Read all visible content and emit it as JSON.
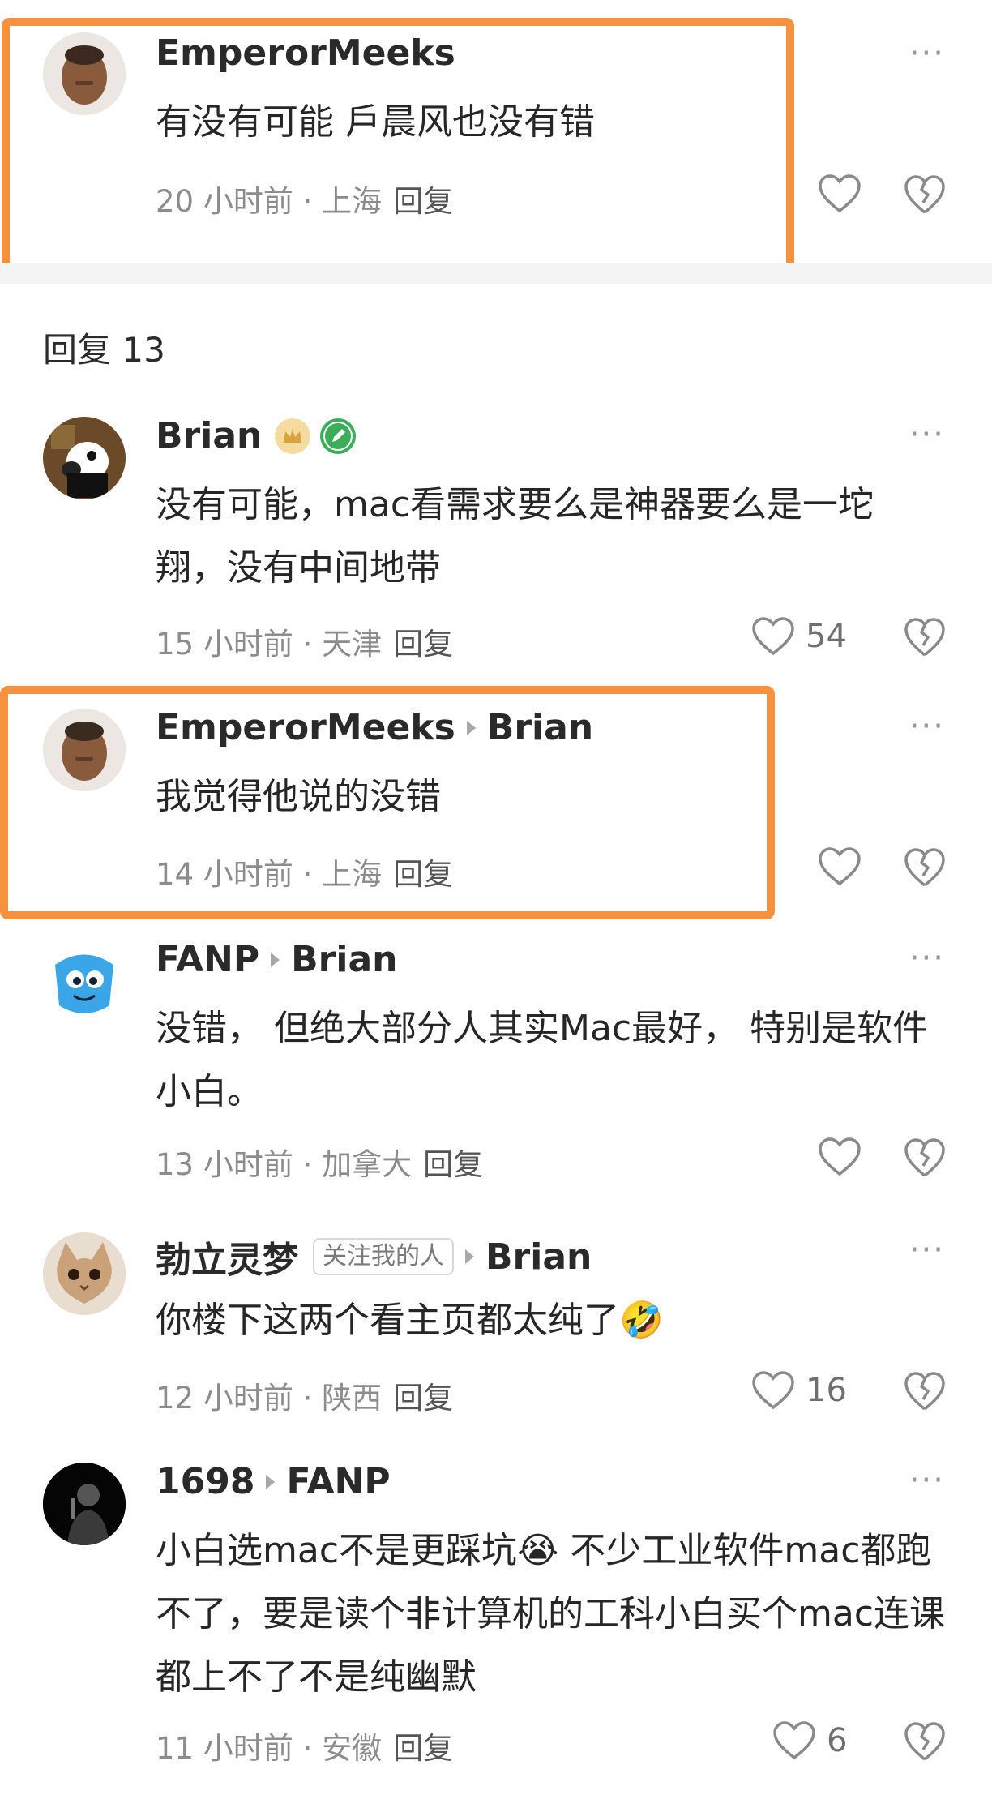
{
  "top_comment": {
    "user": "EmperorMeeks",
    "text": "有没有可能 戶晨风也没有错",
    "time": "20 小时前",
    "location": "上海",
    "reply": "回复"
  },
  "replies_header": "回复 13",
  "replies": [
    {
      "user": "Brian",
      "text": "没有可能，mac看需求要么是神器要么是一坨翔，没有中间地带",
      "time": "15 小时前",
      "location": "天津",
      "reply": "回复",
      "likes": "54"
    },
    {
      "user": "EmperorMeeks",
      "target": "Brian",
      "text": "我觉得他说的没错",
      "time": "14 小时前",
      "location": "上海",
      "reply": "回复",
      "likes": ""
    },
    {
      "user": "FANP",
      "target": "Brian",
      "text": "没错， 但绝大部分人其实Mac最好， 特别是软件小白。",
      "time": "13 小时前",
      "location": "加拿大",
      "reply": "回复",
      "likes": ""
    },
    {
      "user": "勃立灵梦",
      "tag": "关注我的人",
      "target": "Brian",
      "text": "你楼下这两个看主页都太纯了🤣",
      "time": "12 小时前",
      "location": "陕西",
      "reply": "回复",
      "likes": "16"
    },
    {
      "user": "1698",
      "target": "FANP",
      "text": "小白选mac不是更踩坑😭 不少工业软件mac都跑不了，要是读个非计算机的工科小白买个mac连课都上不了不是纯幽默",
      "time": "11 小时前",
      "location": "安徽",
      "reply": "回复",
      "likes": "6"
    }
  ],
  "icons": {
    "more": "more-dots-icon",
    "like": "heart-icon",
    "dislike": "broken-heart-icon",
    "arrow": "reply-arrow-icon"
  },
  "colors": {
    "highlight": "#f5913f",
    "meta": "#8c8c8c"
  }
}
